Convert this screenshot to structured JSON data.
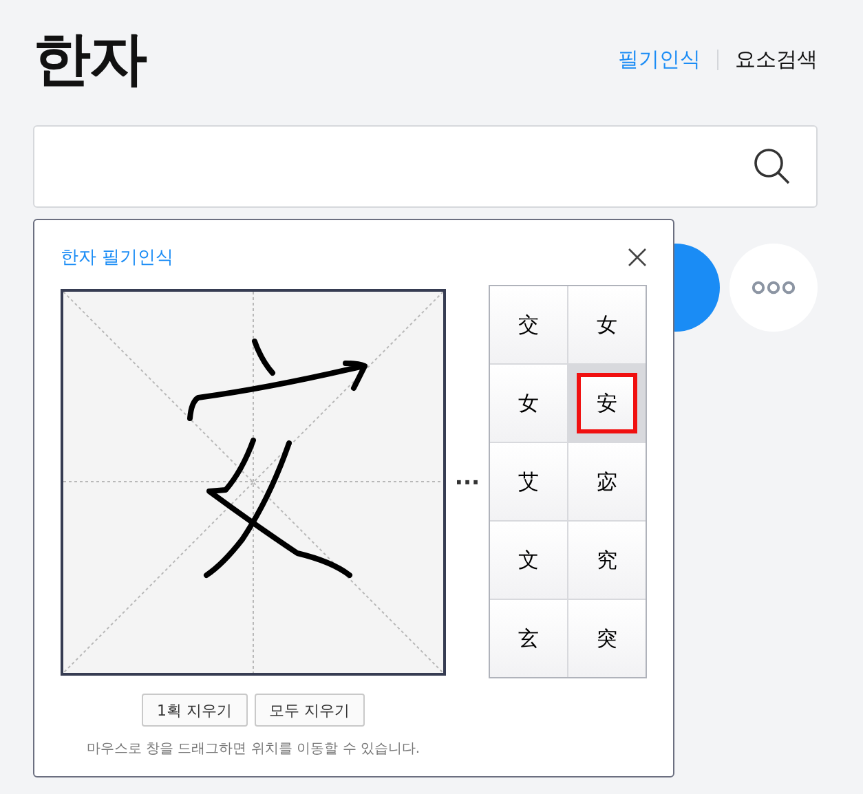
{
  "title": "한자",
  "tabs": [
    {
      "label": "필기인식",
      "selected": true
    },
    {
      "label": "요소검색",
      "selected": false
    }
  ],
  "popup": {
    "title": "한자 필기인식",
    "more": "···",
    "candidates": [
      {
        "char": "交",
        "selected": false
      },
      {
        "char": "女",
        "selected": false
      },
      {
        "char": "女",
        "selected": false
      },
      {
        "char": "安",
        "selected": true
      },
      {
        "char": "艾",
        "selected": false
      },
      {
        "char": "宓",
        "selected": false
      },
      {
        "char": "文",
        "selected": false
      },
      {
        "char": "究",
        "selected": false
      },
      {
        "char": "玄",
        "selected": false
      },
      {
        "char": "突",
        "selected": false
      }
    ],
    "buttons": [
      "1획 지우기",
      "모두 지우기"
    ],
    "hint": "마우스로 창을 드래그하면 위치를 이동할 수 있습니다."
  }
}
